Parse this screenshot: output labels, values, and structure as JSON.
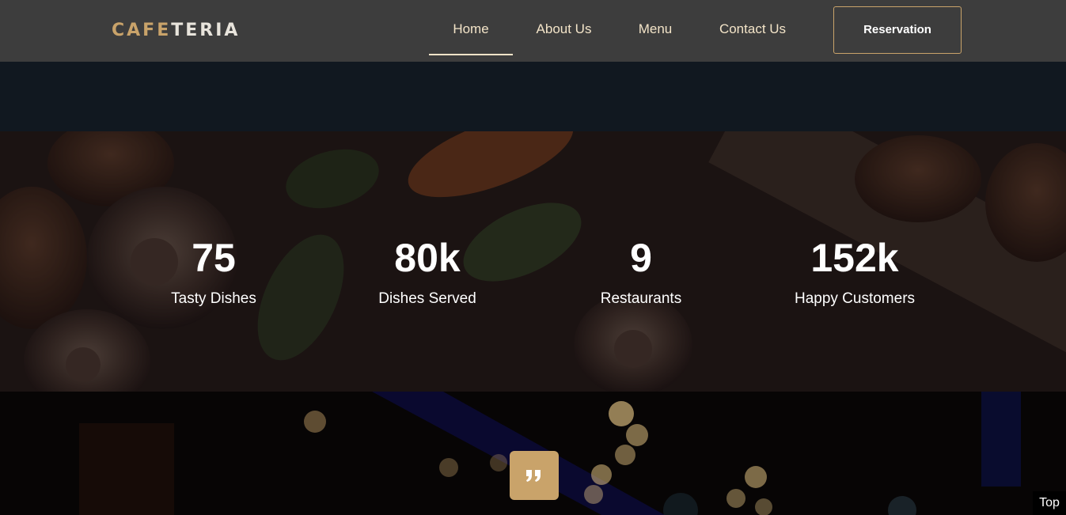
{
  "header": {
    "logo_part1": "CAFE",
    "logo_part2": "TERIA",
    "nav": [
      {
        "label": "Home",
        "active": true
      },
      {
        "label": "About Us"
      },
      {
        "label": "Menu"
      },
      {
        "label": "Contact Us"
      }
    ],
    "reservation_label": "Reservation"
  },
  "stats": [
    {
      "number": "75",
      "label": "Tasty Dishes"
    },
    {
      "number": "80k",
      "label": "Dishes Served"
    },
    {
      "number": "9",
      "label": "Restaurants"
    },
    {
      "number": "152k",
      "label": "Happy Customers"
    }
  ],
  "testimonial": {
    "quote_icon": "quote-icon"
  },
  "back_to_top_label": "Top",
  "colors": {
    "accent": "#c9a36a",
    "nav_bg": "#3d3d3d",
    "nav_text": "#f3e4c8",
    "band_bg": "#111820"
  }
}
